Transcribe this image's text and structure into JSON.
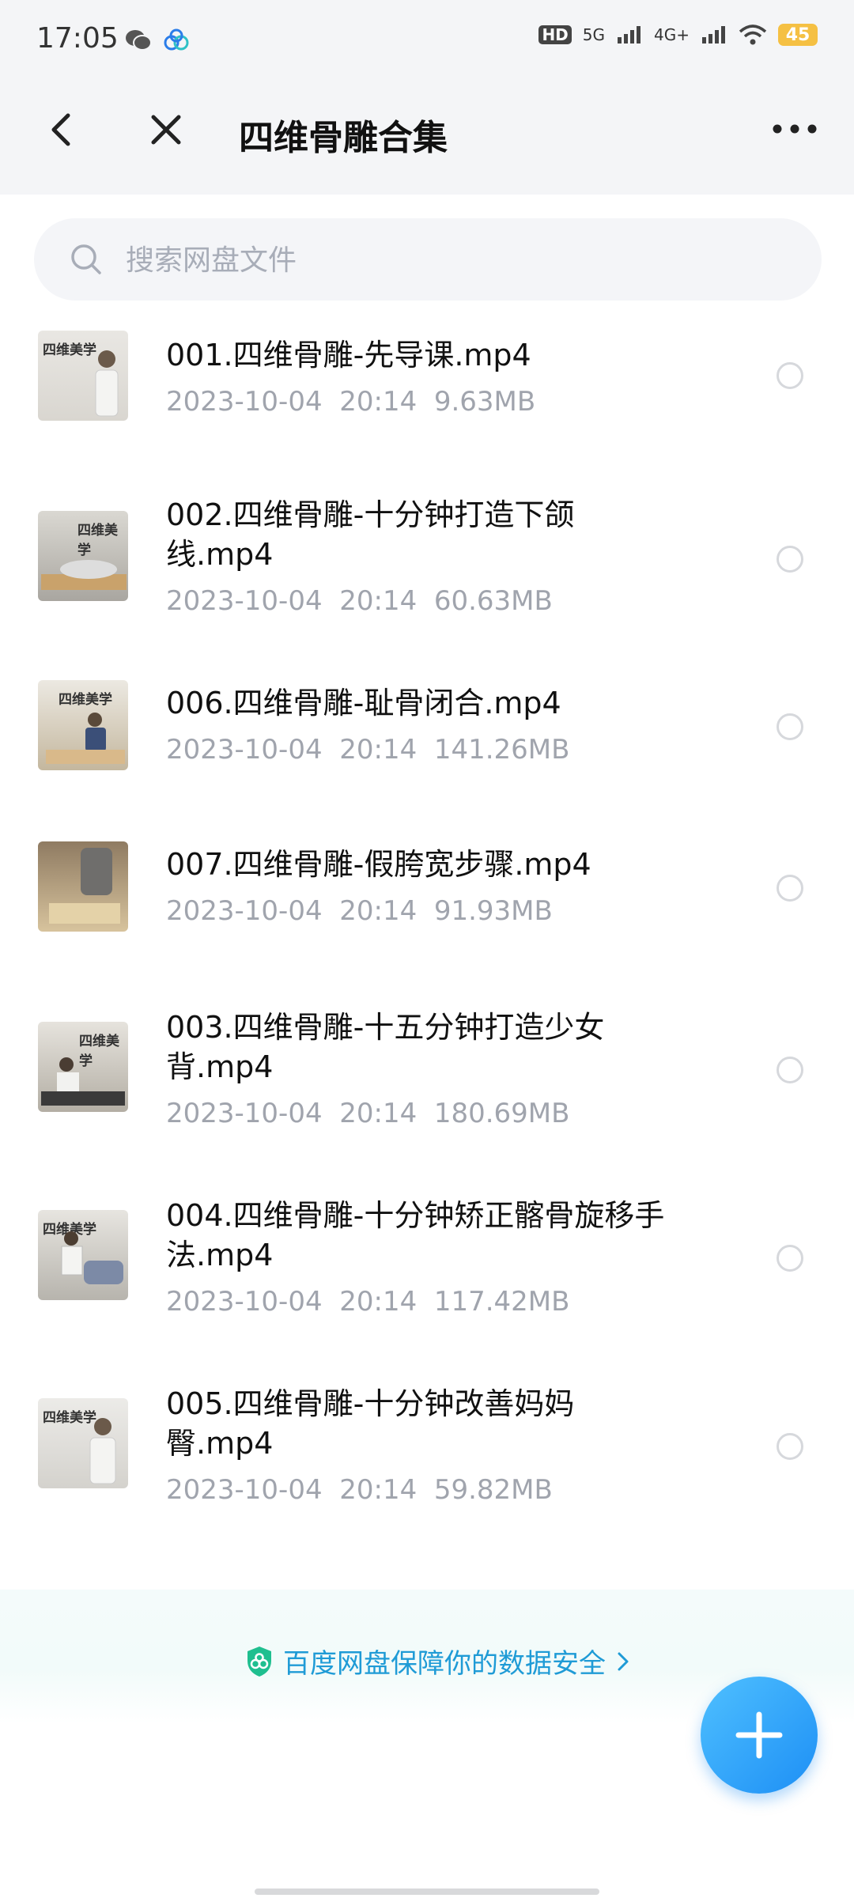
{
  "status_bar": {
    "time": "17:05",
    "network_hd": "HD",
    "network_5g": "5G",
    "network_4g": "4G+",
    "battery": "45"
  },
  "nav": {
    "title": "四维骨雕合集"
  },
  "search": {
    "placeholder": "搜索网盘文件"
  },
  "files": [
    {
      "name": "001.四维骨雕-先导课.mp4",
      "date": "2023-10-04",
      "time": "20:14",
      "size": "9.63MB",
      "thumb_label": "四维美学"
    },
    {
      "name": "002.四维骨雕-十分钟打造下颌\n线.mp4",
      "date": "2023-10-04",
      "time": "20:14",
      "size": "60.63MB",
      "thumb_label": "四维美学"
    },
    {
      "name": "006.四维骨雕-耻骨闭合.mp4",
      "date": "2023-10-04",
      "time": "20:14",
      "size": "141.26MB",
      "thumb_label": "四维美学"
    },
    {
      "name": "007.四维骨雕-假胯宽步骤.mp4",
      "date": "2023-10-04",
      "time": "20:14",
      "size": "91.93MB",
      "thumb_label": ""
    },
    {
      "name": "003.四维骨雕-十五分钟打造少女\n背.mp4",
      "date": "2023-10-04",
      "time": "20:14",
      "size": "180.69MB",
      "thumb_label": "四维美学"
    },
    {
      "name": "004.四维骨雕-十分钟矫正髂骨旋移手\n法.mp4",
      "date": "2023-10-04",
      "time": "20:14",
      "size": "117.42MB",
      "thumb_label": "四维美学"
    },
    {
      "name": "005.四维骨雕-十分钟改善妈妈\n臀.mp4",
      "date": "2023-10-04",
      "time": "20:14",
      "size": "59.82MB",
      "thumb_label": "四维美学"
    }
  ],
  "security": {
    "text": "百度网盘保障你的数据安全"
  },
  "colors": {
    "accent": "#1f9bd6",
    "fab": "#1d8ff5",
    "meta_text": "#a0a4ad"
  }
}
